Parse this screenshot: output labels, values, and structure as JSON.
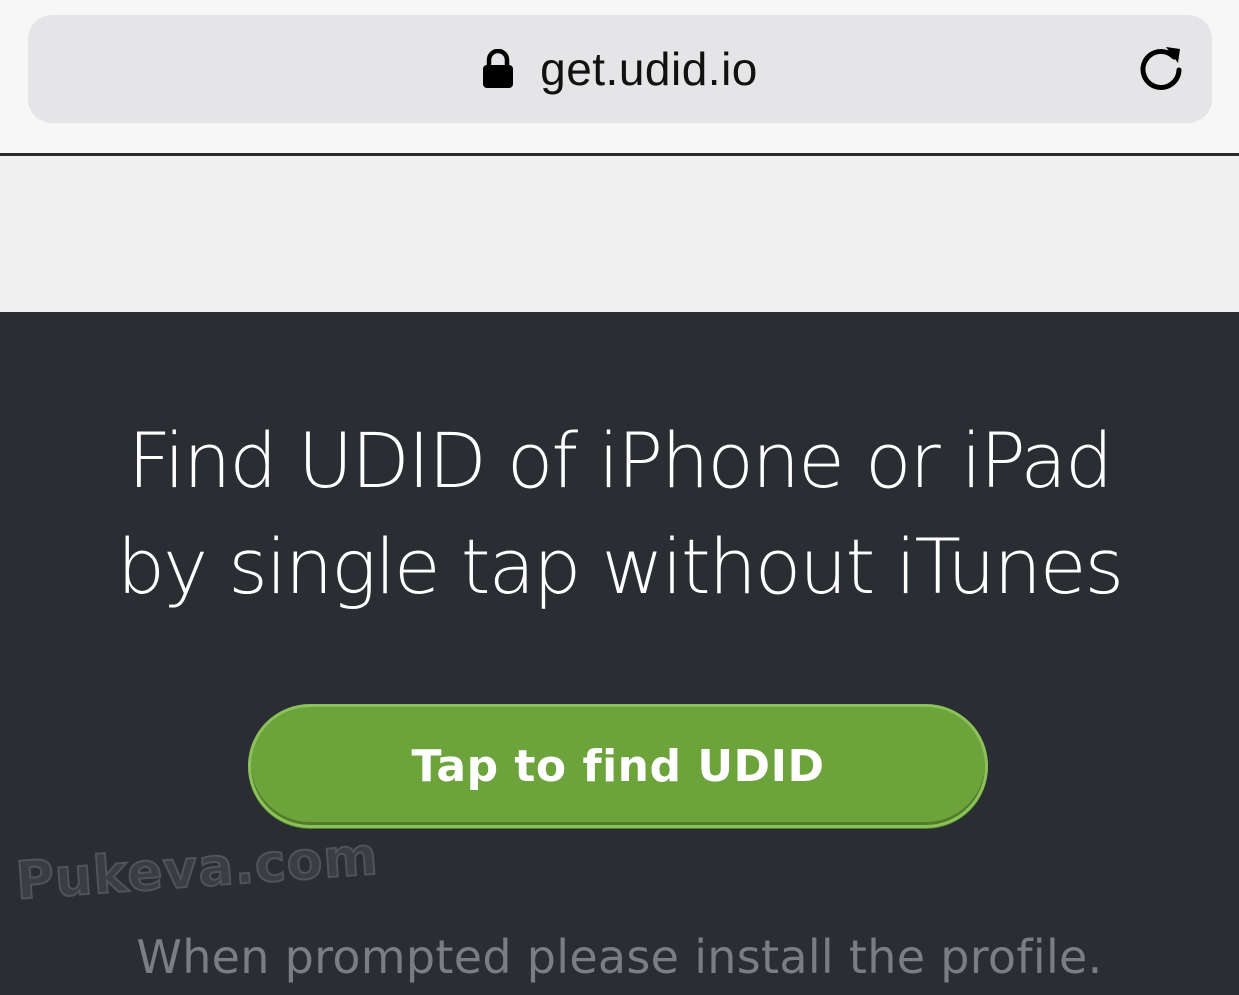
{
  "browser": {
    "url": "get.udid.io",
    "lock_icon": "lock-icon",
    "reload_icon": "reload-icon"
  },
  "hero": {
    "headline_line1": "Find UDID of iPhone or iPad",
    "headline_line2": "by single tap without iTunes",
    "cta_label": "Tap to find UDID",
    "prompt": "When prompted please install the profile."
  },
  "watermark": "Pukeva.com",
  "colors": {
    "hero_background": "#2a2d32",
    "cta_green": "#6da33b",
    "address_bar": "#e5e5e8"
  }
}
